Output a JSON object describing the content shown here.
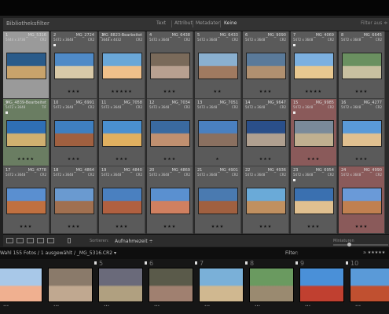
{
  "library_filter": {
    "title": "Bibliotheksfilter",
    "tabs": [
      "Text",
      "Attribut",
      "Metadaten",
      "Keine"
    ],
    "active_tab": "Keine",
    "preset": "Filter aus ≑"
  },
  "grid": {
    "cells": [
      {
        "num": "1",
        "fname": "_MG_5316",
        "dims": "5444 x 3736",
        "ext": "CR2",
        "stars": "",
        "state": "sel",
        "flag": false
      },
      {
        "num": "2",
        "fname": "_MG_2724",
        "dims": "5472 x 3648",
        "ext": "CR2",
        "stars": "★★★",
        "state": "",
        "flag": true
      },
      {
        "num": "3",
        "fname": "_MG_8823-Bearbeitet",
        "dims": "3648 x 4432",
        "ext": "CR2",
        "stars": "★★★★★",
        "state": "",
        "flag": false
      },
      {
        "num": "4",
        "fname": "_MG_6438",
        "dims": "5472 x 3648",
        "ext": "CR2",
        "stars": "★★★",
        "state": "",
        "flag": false
      },
      {
        "num": "5",
        "fname": "_MG_6433",
        "dims": "5472 x 3648",
        "ext": "CR2",
        "stars": "★★",
        "state": "",
        "flag": false
      },
      {
        "num": "6",
        "fname": "_MG_9090",
        "dims": "5472 x 3648",
        "ext": "CR2",
        "stars": "★★★",
        "state": "",
        "flag": false
      },
      {
        "num": "7",
        "fname": "_MG_4069",
        "dims": "5472 x 3648",
        "ext": "CR2",
        "stars": "★★★★",
        "state": "",
        "flag": true
      },
      {
        "num": "8",
        "fname": "_MG_6645",
        "dims": "5472 x 3648",
        "ext": "CR2",
        "stars": "★★★",
        "state": "",
        "flag": false
      },
      {
        "num": "9",
        "fname": "_MG_4839-Bearbeitet",
        "dims": "5472 x 3648",
        "ext": "TIF",
        "stars": "★★★★",
        "state": "green",
        "flag": true
      },
      {
        "num": "10",
        "fname": "_MG_6991",
        "dims": "5472 x 3648",
        "ext": "CR2",
        "stars": "★★★",
        "state": "",
        "flag": false
      },
      {
        "num": "11",
        "fname": "_MG_7058",
        "dims": "5472 x 3648",
        "ext": "CR2",
        "stars": "★★★",
        "state": "",
        "flag": false
      },
      {
        "num": "12",
        "fname": "_MG_7034",
        "dims": "5472 x 3648",
        "ext": "CR2",
        "stars": "★★★",
        "state": "",
        "flag": false
      },
      {
        "num": "13",
        "fname": "_MG_7051",
        "dims": "5472 x 3648",
        "ext": "CR2",
        "stars": "★",
        "state": "",
        "flag": false
      },
      {
        "num": "14",
        "fname": "_MG_9647",
        "dims": "5472 x 3648",
        "ext": "CR2",
        "stars": "★★★",
        "state": "",
        "flag": false
      },
      {
        "num": "15",
        "fname": "_MG_9985",
        "dims": "5472 x 3648",
        "ext": "CR2",
        "stars": "★★★",
        "state": "red",
        "flag": true
      },
      {
        "num": "16",
        "fname": "_MG_4277",
        "dims": "5472 x 3648",
        "ext": "CR2",
        "stars": "★★★",
        "state": "",
        "flag": false
      },
      {
        "num": "17",
        "fname": "_MG_4778",
        "dims": "5472 x 3648",
        "ext": "CR2",
        "stars": "★★★",
        "state": "",
        "flag": false
      },
      {
        "num": "18",
        "fname": "_MG_4864",
        "dims": "5472 x 3648",
        "ext": "CR2",
        "stars": "★★★",
        "state": "",
        "flag": false
      },
      {
        "num": "19",
        "fname": "_MG_4840",
        "dims": "5472 x 3648",
        "ext": "CR2",
        "stars": "★★★",
        "state": "",
        "flag": false
      },
      {
        "num": "20",
        "fname": "_MG_4869",
        "dims": "5472 x 3648",
        "ext": "CR2",
        "stars": "★★★",
        "state": "",
        "flag": false
      },
      {
        "num": "21",
        "fname": "_MG_4901",
        "dims": "5472 x 3648",
        "ext": "CR2",
        "stars": "★★★",
        "state": "",
        "flag": false
      },
      {
        "num": "22",
        "fname": "_MG_4936",
        "dims": "5472 x 3648",
        "ext": "CR2",
        "stars": "★★★",
        "state": "",
        "flag": false
      },
      {
        "num": "23",
        "fname": "_MG_6954",
        "dims": "5472 x 3648",
        "ext": "CR2",
        "stars": "★★★",
        "state": "",
        "flag": true
      },
      {
        "num": "24",
        "fname": "_MG_4990",
        "dims": "5472 x 3648",
        "ext": "CR2",
        "stars": "★★★",
        "state": "red",
        "flag": false
      }
    ]
  },
  "toolbar": {
    "sort_label": "Sortieren:",
    "sort_value": "Aufnahmezeit ÷",
    "thumbs_label": "Miniaturen"
  },
  "statusbar": {
    "text": "Wahl   155 Fotos / 1 ausgewählt / _MG_5316.CR2 ▾",
    "filter_label": "Filter:",
    "filter_stars": "≥ ★★★★★"
  },
  "filmstrip": {
    "numbers": [
      "5",
      "6",
      "7",
      "8",
      "9",
      "10"
    ],
    "stars": [
      "•••",
      "•••",
      "•••",
      "•••",
      "•••",
      "•••",
      "•••",
      "•••"
    ]
  }
}
